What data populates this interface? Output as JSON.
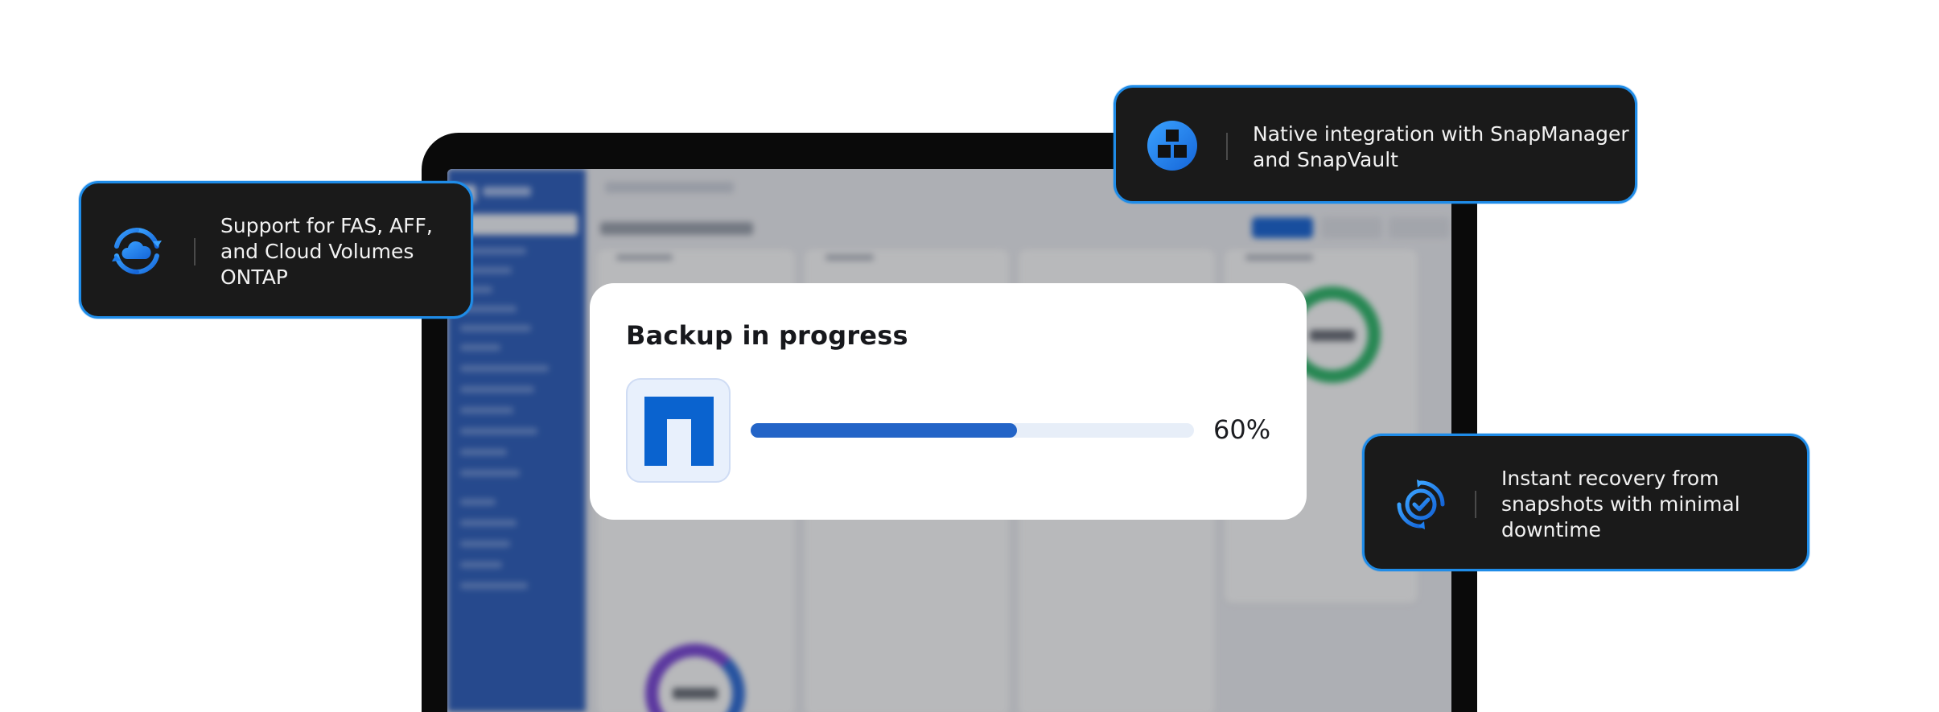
{
  "backup": {
    "title": "Backup in progress",
    "progress_percent": 60,
    "progress_label": "60%",
    "logo_icon": "netapp-logo-icon",
    "accent_color": "#2364c7",
    "track_color": "#e7eef8"
  },
  "features": {
    "support": {
      "icon": "cloud-sync-icon",
      "lines": [
        "Support for FAS, AFF,",
        "and Cloud Volumes",
        "ONTAP"
      ]
    },
    "native": {
      "icon": "blocks-integration-icon",
      "lines": [
        "Native integration with SnapManager",
        "and SnapVault"
      ]
    },
    "instant": {
      "icon": "recovery-check-icon",
      "lines": [
        "Instant recovery from",
        "snapshots with minimal",
        "downtime"
      ]
    }
  },
  "colors": {
    "callout_background": "#1a1a1a",
    "callout_border": "#1f8ce8",
    "icon_gradient_start": "#1e90ff",
    "icon_gradient_end": "#1565d8",
    "sidebar_blue": "#2e5fbd"
  }
}
